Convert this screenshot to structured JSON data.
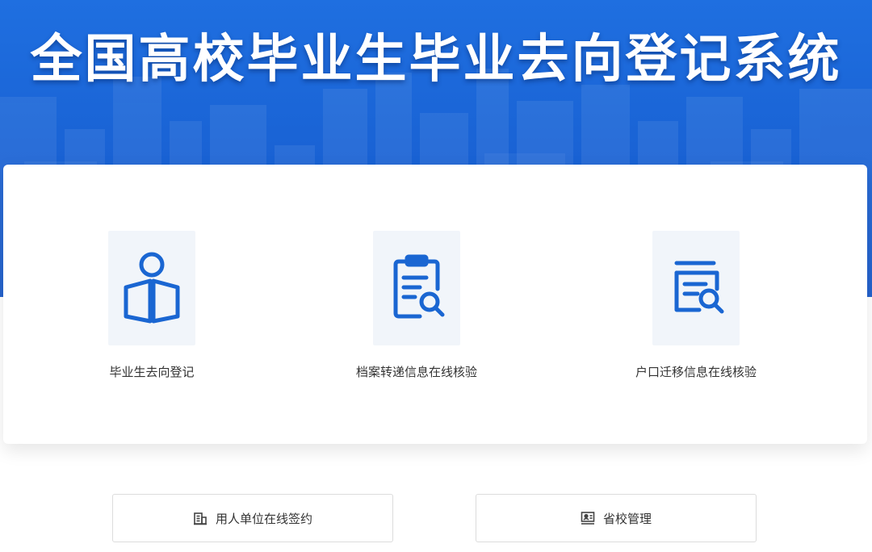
{
  "header": {
    "title": "全国高校毕业生毕业去向登记系统"
  },
  "features": [
    {
      "label": "毕业生去向登记",
      "icon": "person-reading-icon"
    },
    {
      "label": "档案转递信息在线核验",
      "icon": "clipboard-search-icon"
    },
    {
      "label": "户口迁移信息在线核验",
      "icon": "document-search-icon"
    }
  ],
  "buttons": [
    {
      "label": "用人单位在线签约",
      "icon": "building-icon"
    },
    {
      "label": "省校管理",
      "icon": "management-icon"
    }
  ],
  "colors": {
    "primary": "#1f6fe0",
    "icon": "#1a66d2",
    "icon_bg": "#f1f5fa"
  }
}
